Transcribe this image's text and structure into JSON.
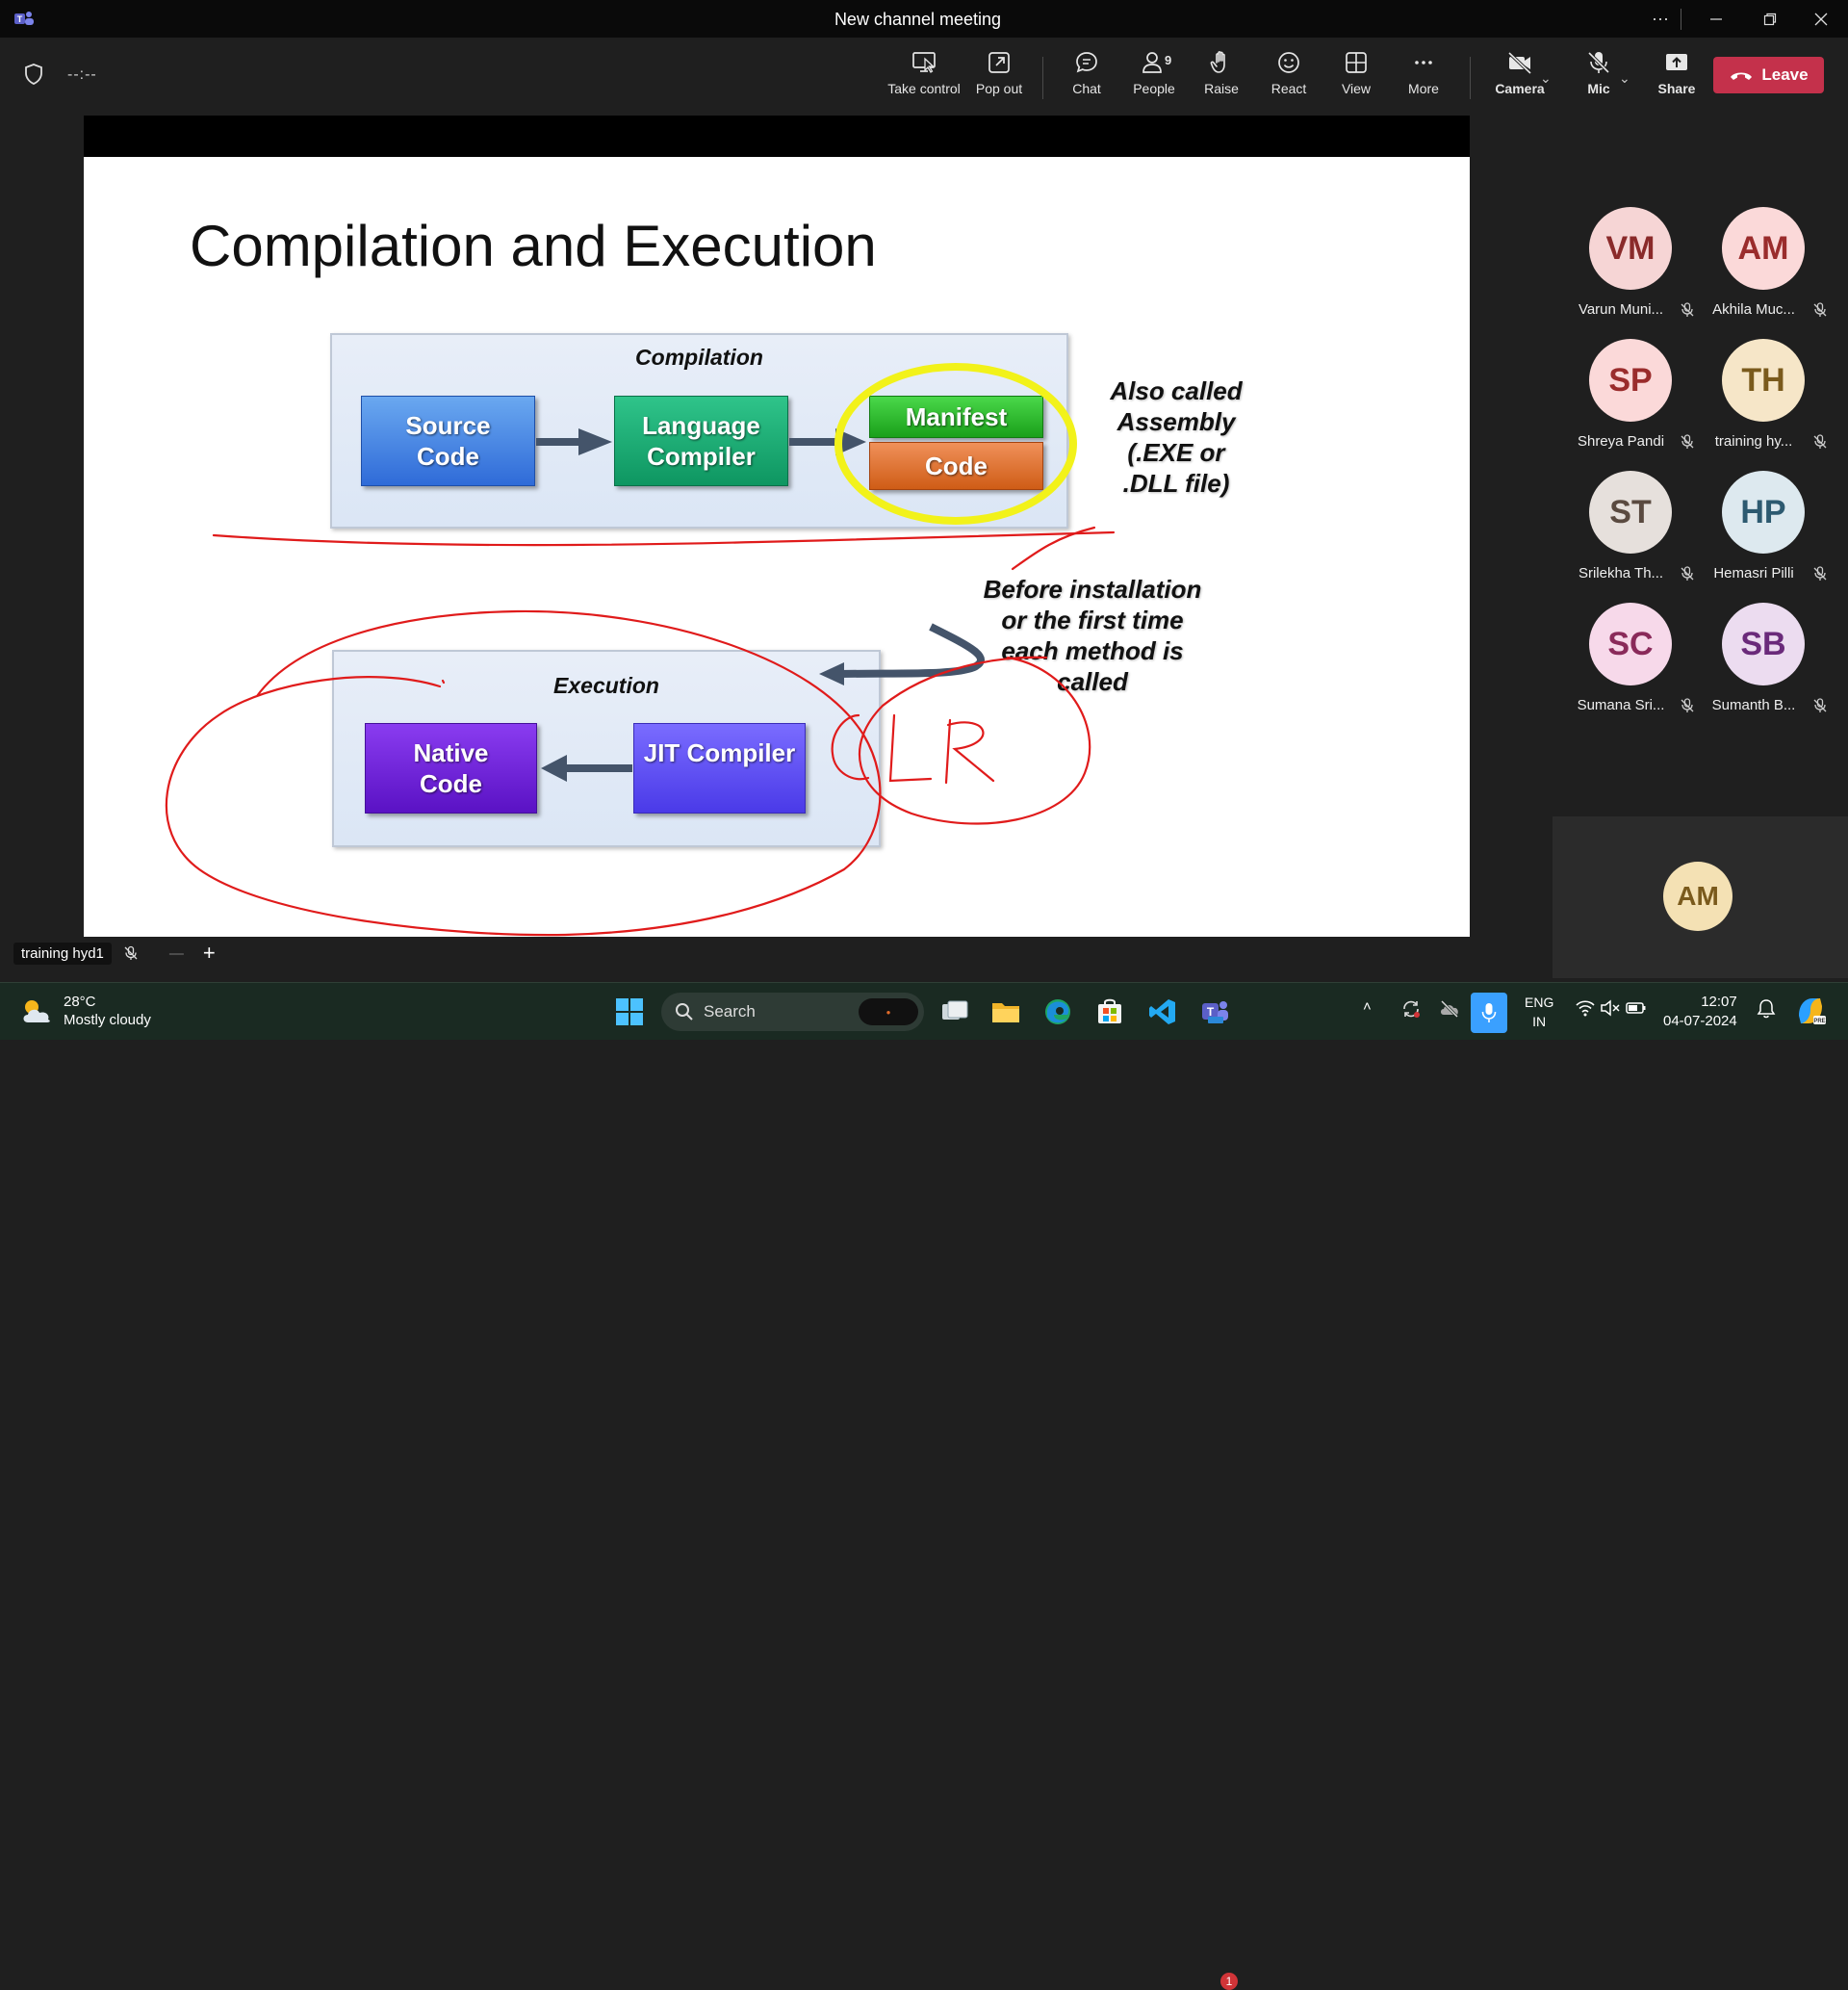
{
  "window": {
    "title": "New channel meeting",
    "more_label": "···"
  },
  "toolbar": {
    "timer": "--:--",
    "take_control": "Take control",
    "pop_out": "Pop out",
    "chat": "Chat",
    "people": "People",
    "people_count": "9",
    "raise": "Raise",
    "react": "React",
    "view": "View",
    "more": "More",
    "camera": "Camera",
    "mic": "Mic",
    "share": "Share",
    "leave": "Leave",
    "leave_color": "#c4314b"
  },
  "slide": {
    "title": "Compilation and Execution",
    "compilation_title": "Compilation",
    "source_code": "Source\nCode",
    "language_compiler": "Language\nCompiler",
    "manifest": "Manifest",
    "code": "Code",
    "also_called": "Also called\nAssembly\n(.EXE or\n.DLL file)",
    "before_installation": "Before installation\nor the first time\neach method is\ncalled",
    "execution_title": "Execution",
    "native_code": "Native\nCode",
    "jit_compiler": "JIT Compiler",
    "annotation_text": "CLR",
    "annotation_color": "#e01b1b",
    "highlight_color": "#f2f21a"
  },
  "presenter": {
    "name": "training hyd1",
    "minus": "—",
    "plus": "+"
  },
  "participants": [
    {
      "initials": "VM",
      "name": "Varun Muni...",
      "bg": "#f6d5d5",
      "fg": "#8a2a2a"
    },
    {
      "initials": "AM",
      "name": "Akhila Muc...",
      "bg": "#fbd9d9",
      "fg": "#9a2c2c"
    },
    {
      "initials": "SP",
      "name": "Shreya Pandi",
      "bg": "#fbd9d9",
      "fg": "#9a2c2c"
    },
    {
      "initials": "TH",
      "name": "training hy...",
      "bg": "#f6e6c8",
      "fg": "#7a5a1c"
    },
    {
      "initials": "ST",
      "name": "Srilekha Th...",
      "bg": "#e6e0dc",
      "fg": "#5a4a40"
    },
    {
      "initials": "HP",
      "name": "Hemasri Pilli",
      "bg": "#dde9ef",
      "fg": "#2d5a70"
    },
    {
      "initials": "SC",
      "name": "Sumana Sri...",
      "bg": "#f7d9ea",
      "fg": "#8a2a5a"
    },
    {
      "initials": "SB",
      "name": "Sumanth B...",
      "bg": "#ecdcf0",
      "fg": "#6a2a7a"
    }
  ],
  "self_view": {
    "initials": "AM"
  },
  "taskbar": {
    "temperature": "28°C",
    "weather": "Mostly cloudy",
    "search_placeholder": "Search",
    "teams_badge": "1",
    "lang_top": "ENG",
    "lang_bottom": "IN",
    "time": "12:07",
    "date": "04-07-2024"
  }
}
